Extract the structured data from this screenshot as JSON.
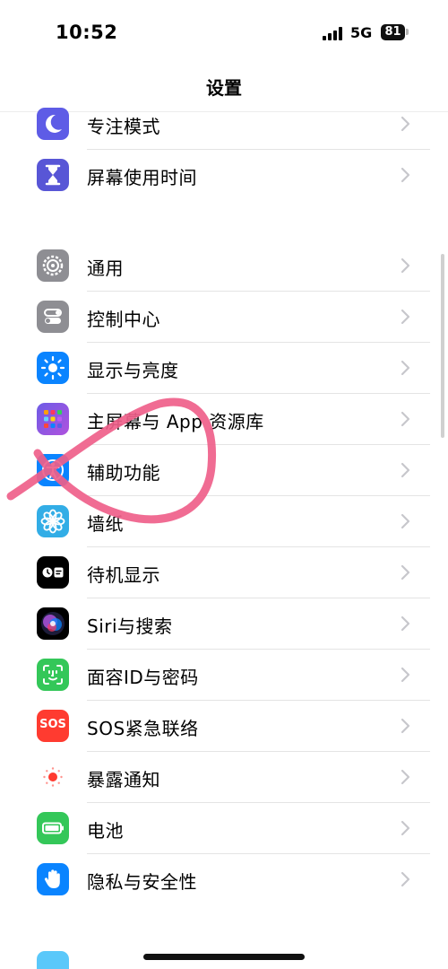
{
  "status_bar": {
    "time": "10:52",
    "network": "5G",
    "battery": "81"
  },
  "nav": {
    "title": "设置"
  },
  "rows": [
    {
      "label": "专注模式"
    },
    {
      "label": "屏幕使用时间"
    },
    {
      "label": "通用"
    },
    {
      "label": "控制中心"
    },
    {
      "label": "显示与亮度"
    },
    {
      "label": "主屏幕与 App 资源库"
    },
    {
      "label": "辅助功能"
    },
    {
      "label": "墙纸"
    },
    {
      "label": "待机显示"
    },
    {
      "label": "Siri与搜索"
    },
    {
      "label": "面容ID与密码"
    },
    {
      "label": "SOS紧急联络"
    },
    {
      "label": "暴露通知"
    },
    {
      "label": "电池"
    },
    {
      "label": "隐私与安全性"
    }
  ],
  "icons": {
    "focus": "moon-icon",
    "screen_time": "hourglass-icon",
    "general": "gear-icon",
    "control_center": "toggles-icon",
    "display": "sun-icon",
    "home_screen": "app-grid-icon",
    "accessibility": "accessibility-person-icon",
    "wallpaper": "flower-icon",
    "standby": "standby-icon",
    "siri": "siri-orb-icon",
    "face_id": "face-id-icon",
    "sos": "sos-icon",
    "exposure": "exposure-dot-icon",
    "battery": "battery-icon",
    "privacy": "hand-icon"
  },
  "icon_text": {
    "sos": "SOS"
  },
  "colors": {
    "focus": "#5e5ce6",
    "screen_time": "#5856d6",
    "general": "#8e8e93",
    "control_center": "#8e8e93",
    "display": "#0a84ff",
    "accessibility": "#0a84ff",
    "wallpaper": "#32ade6",
    "standby": "#000000",
    "face_id": "#34c759",
    "sos": "#ff3b30",
    "exposure": "#ff3b30",
    "battery": "#34c759",
    "privacy": "#0a84ff",
    "annotation": "#ef5f8a"
  }
}
